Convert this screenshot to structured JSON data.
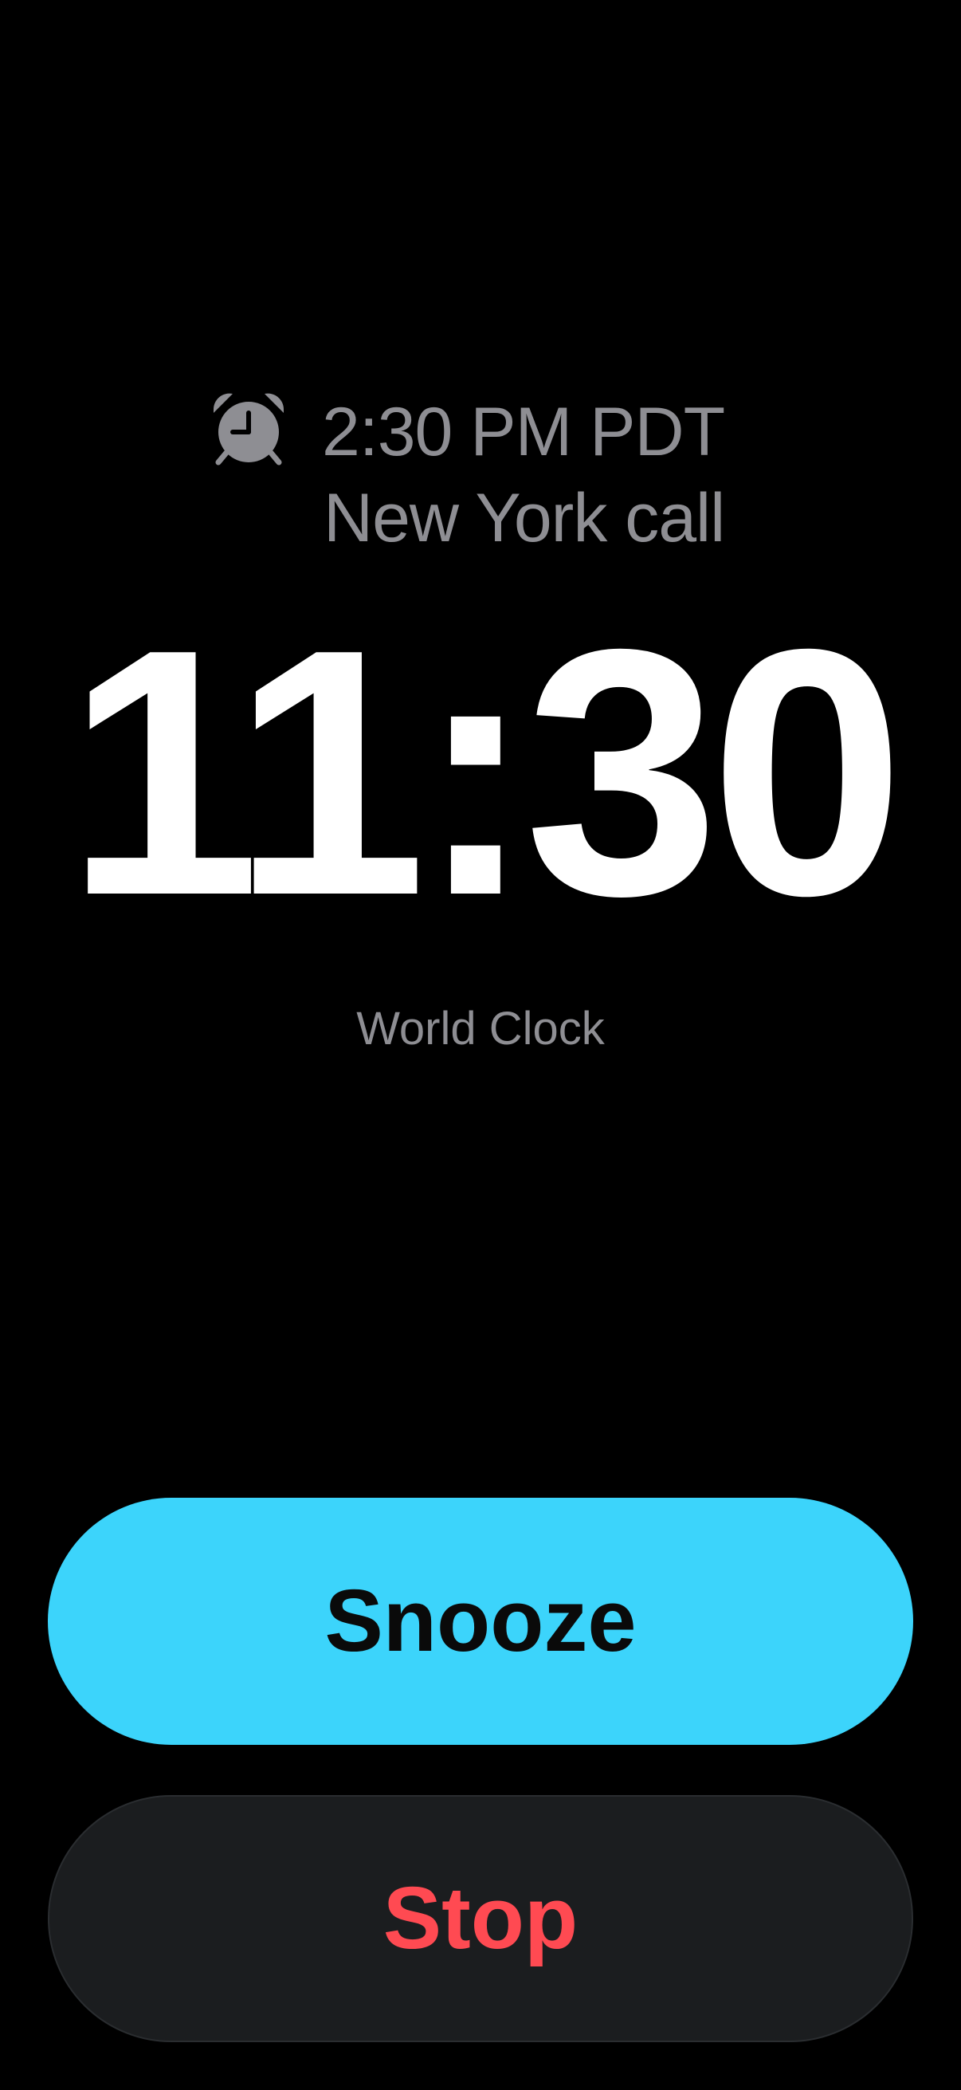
{
  "alarm": {
    "icon": "alarm-clock-icon",
    "time": "2:30 PM PDT",
    "label": "New York call"
  },
  "clock": {
    "time": "11:30",
    "caption": "World Clock"
  },
  "buttons": {
    "snooze_label": "Snooze",
    "stop_label": "Stop"
  },
  "colors": {
    "background": "#000000",
    "snooze_bg": "#3cd4fb",
    "stop_bg": "#1b1d1f",
    "stop_text": "#ff4a52",
    "secondary_text": "#8e8e93"
  }
}
